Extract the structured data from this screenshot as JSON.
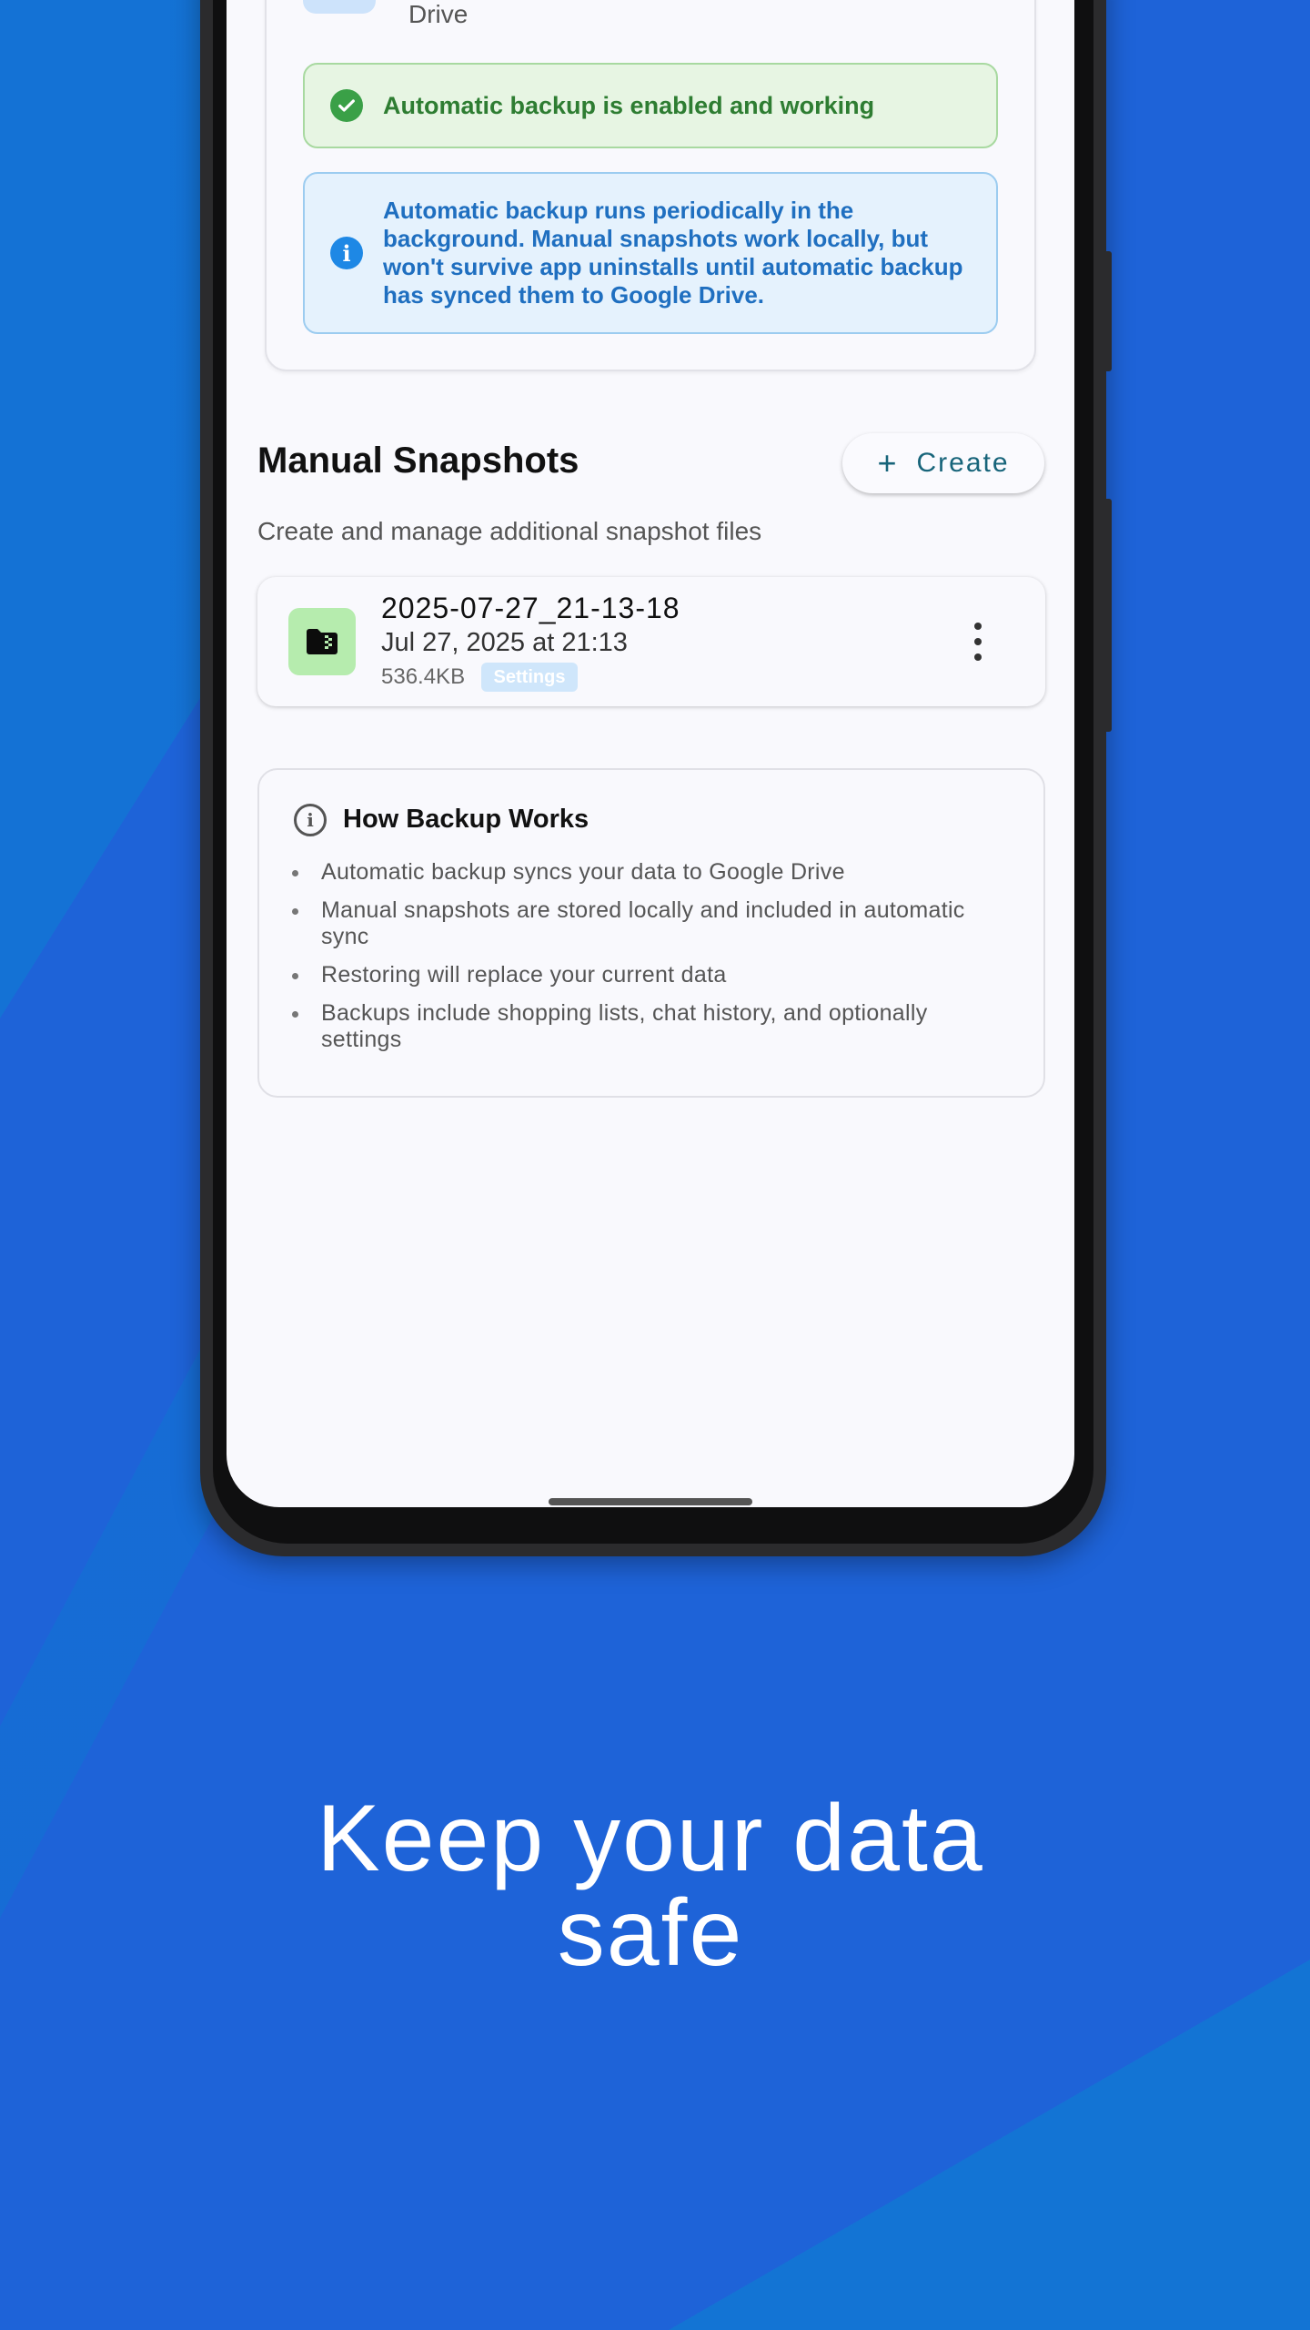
{
  "top_card": {
    "partial_text": "Drive",
    "status_ok": "Automatic backup is enabled and working",
    "info": "Automatic backup runs periodically in the background. Manual snapshots work locally, but won't survive app uninstalls until automatic backup has synced them to Google Drive."
  },
  "manual": {
    "title": "Manual Snapshots",
    "create_label": "Create",
    "subtitle": "Create and manage additional snapshot files"
  },
  "snapshots": [
    {
      "name": "2025-07-27_21-13-18",
      "date": "Jul 27, 2025 at 21:13",
      "size": "536.4KB",
      "badge": "Settings"
    }
  ],
  "how": {
    "title": "How Backup Works",
    "items": [
      "Automatic backup syncs your data to Google Drive",
      "Manual snapshots are stored locally and included in automatic sync",
      "Restoring will replace your current data",
      "Backups include shopping lists, chat history, and optionally settings"
    ]
  },
  "headline": {
    "line1": "Keep your data",
    "line2": "safe"
  },
  "colors": {
    "background": "#1e63d8",
    "accent_green": "#3aa047",
    "accent_blue": "#1e88e5",
    "button_text": "#17647a"
  }
}
